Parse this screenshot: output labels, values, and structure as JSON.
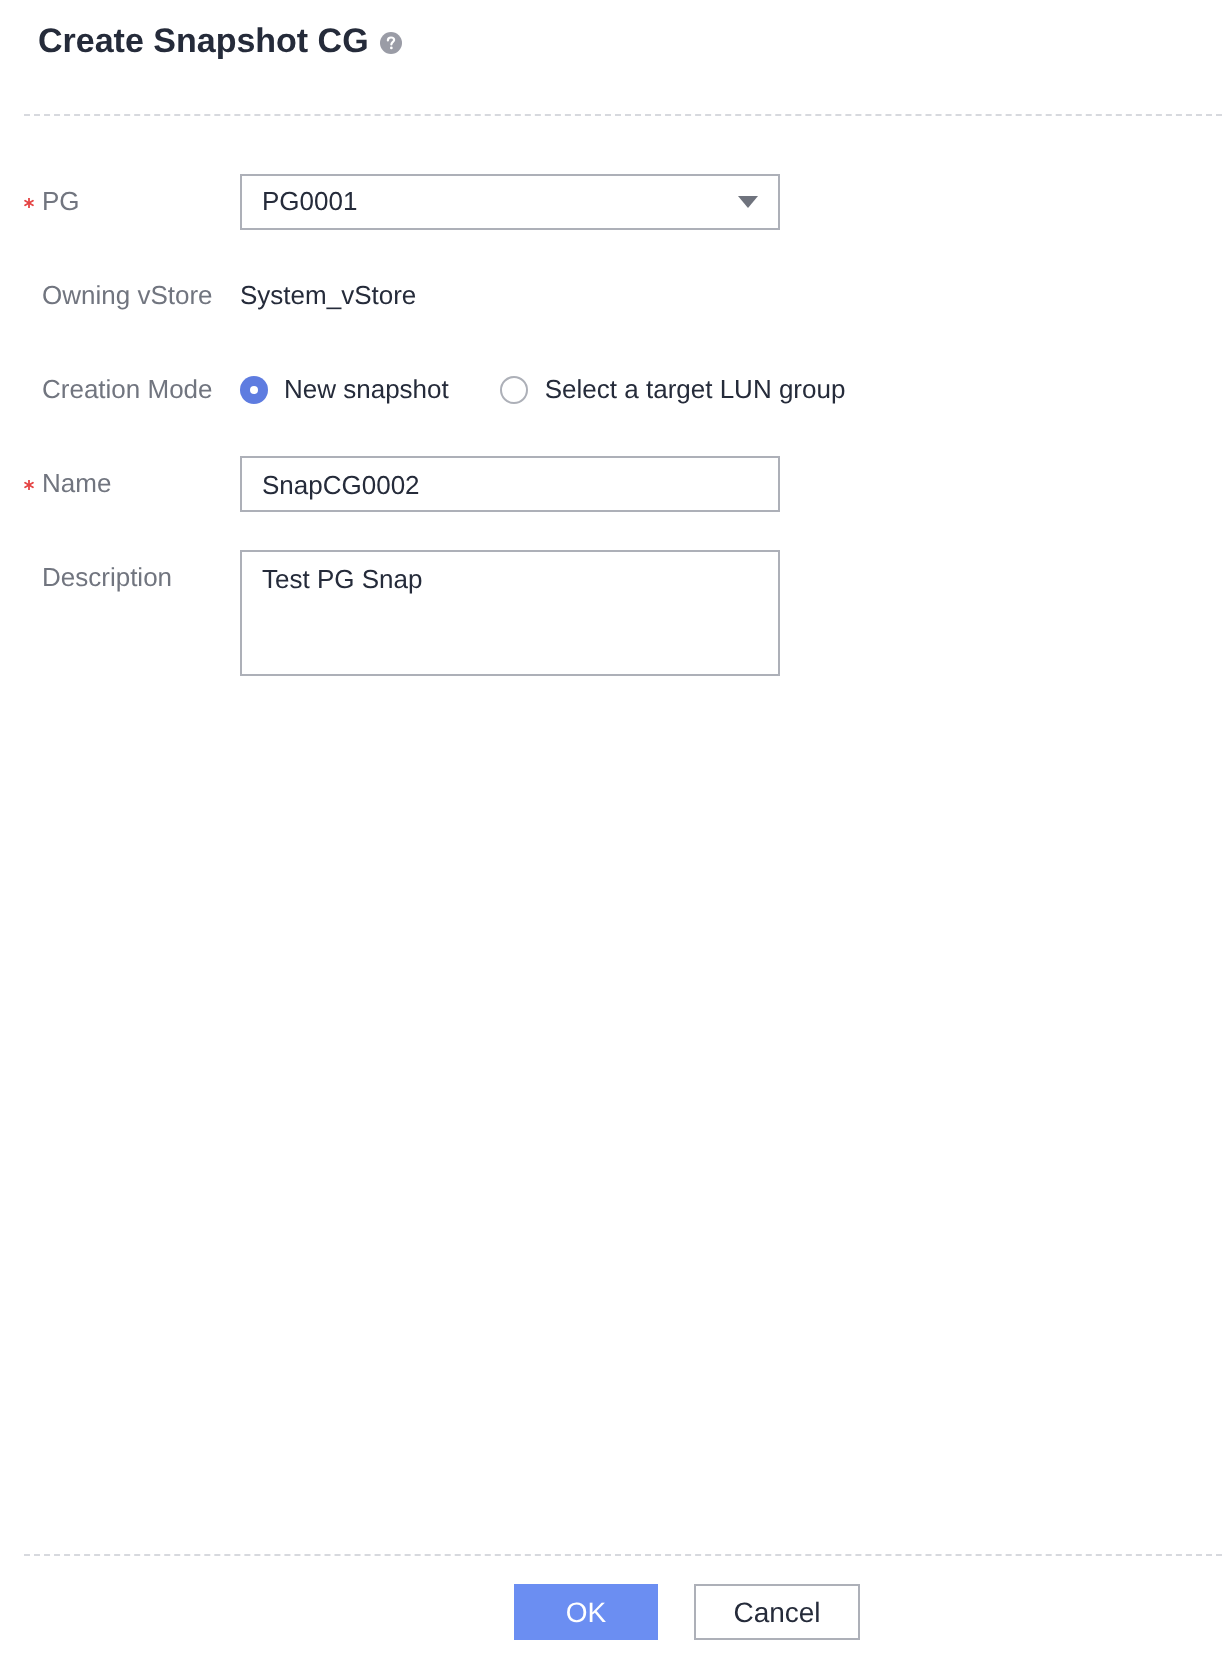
{
  "dialog": {
    "title": "Create Snapshot CG"
  },
  "fields": [
    {
      "kind": "select",
      "label": "PG",
      "required": true,
      "value": "PG0001"
    },
    {
      "kind": "text",
      "label": "Owning vStore",
      "required": false,
      "value": "System_vStore"
    },
    {
      "kind": "radio",
      "label": "Creation Mode",
      "required": false,
      "options": [
        {
          "label": "New snapshot",
          "selected": true
        },
        {
          "label": "Select a target LUN group",
          "selected": false
        }
      ]
    },
    {
      "kind": "input",
      "label": "Name",
      "required": true,
      "value": "SnapCG0002"
    },
    {
      "kind": "textarea",
      "label": "Description",
      "required": false,
      "value": "Test PG Snap"
    }
  ],
  "buttons": [
    {
      "label": "OK",
      "kind": "primary"
    },
    {
      "label": "Cancel",
      "kind": "secondary"
    }
  ]
}
